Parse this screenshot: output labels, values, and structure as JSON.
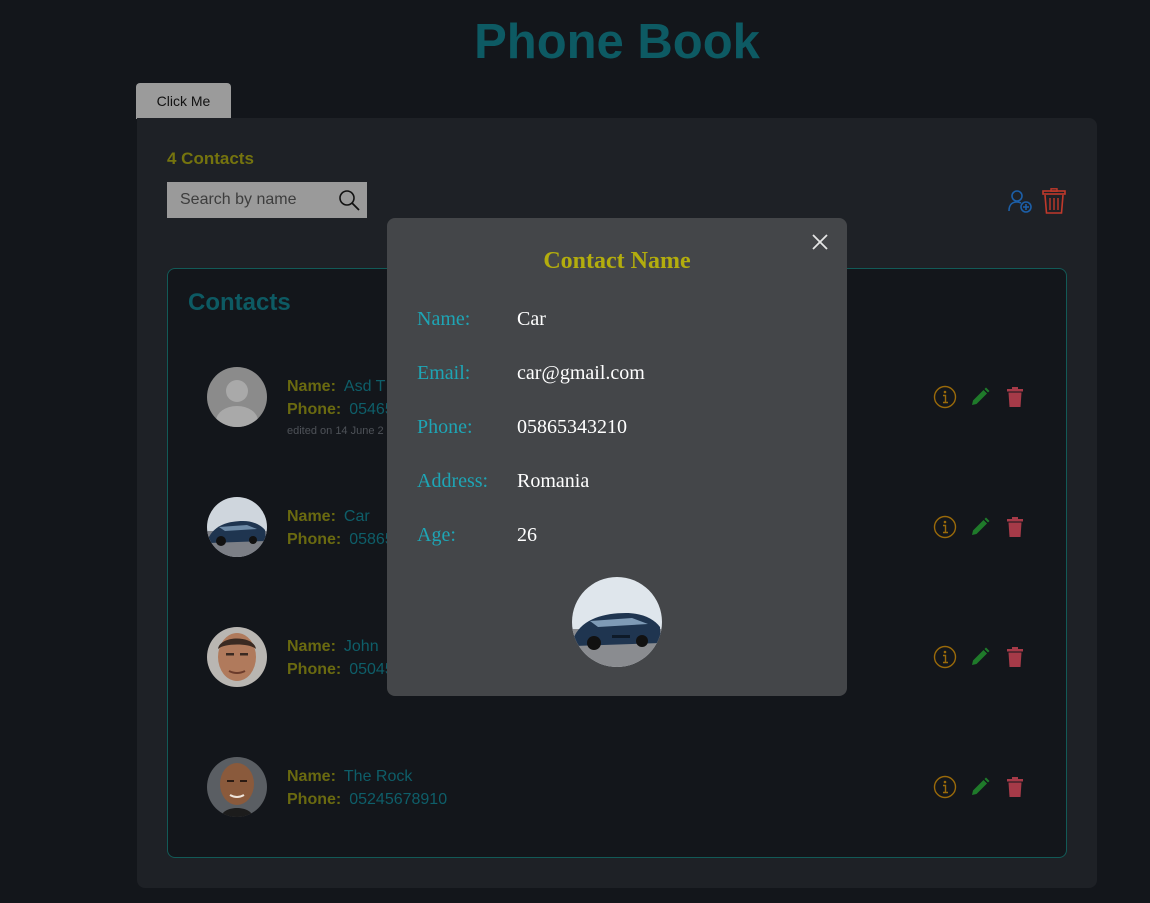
{
  "app": {
    "title": "Phone Book",
    "button_label": "Click Me"
  },
  "toolbar": {
    "count_label": "4 Contacts",
    "search_placeholder": "Search by name",
    "icons": [
      "search-icon",
      "add-contact-icon",
      "trash-icon"
    ]
  },
  "contacts": {
    "heading": "Contacts",
    "name_label": "Name:",
    "phone_label": "Phone:",
    "items": [
      {
        "name": "Asd T",
        "phone": "05465",
        "edited": "edited on 14 June 2",
        "avatar": "default-avatar"
      },
      {
        "name": "Car",
        "phone": "05865",
        "avatar": "car-photo"
      },
      {
        "name": "John",
        "phone": "05045",
        "avatar": "person-photo"
      },
      {
        "name": "The Rock",
        "phone": "05245678910",
        "avatar": "person-photo"
      }
    ]
  },
  "modal": {
    "title": "Contact Name",
    "fields": [
      {
        "label": "Name:",
        "value": "Car"
      },
      {
        "label": "Email:",
        "value": "car@gmail.com"
      },
      {
        "label": "Phone:",
        "value": "05865343210"
      },
      {
        "label": "Address:",
        "value": "Romania"
      },
      {
        "label": "Age:",
        "value": "26"
      }
    ],
    "photo": "car-photo"
  },
  "colors": {
    "title": "#0d5a63",
    "count": "#75740e",
    "modal_title": "#b3ad0d",
    "modal_label": "#1ea5b5",
    "info_icon": "#9a6a0a",
    "edit_icon": "#1f7a2a",
    "delete_icon": "#a63a48",
    "add_icon": "#1c5fa8",
    "trash_all_icon": "#c0392b"
  }
}
